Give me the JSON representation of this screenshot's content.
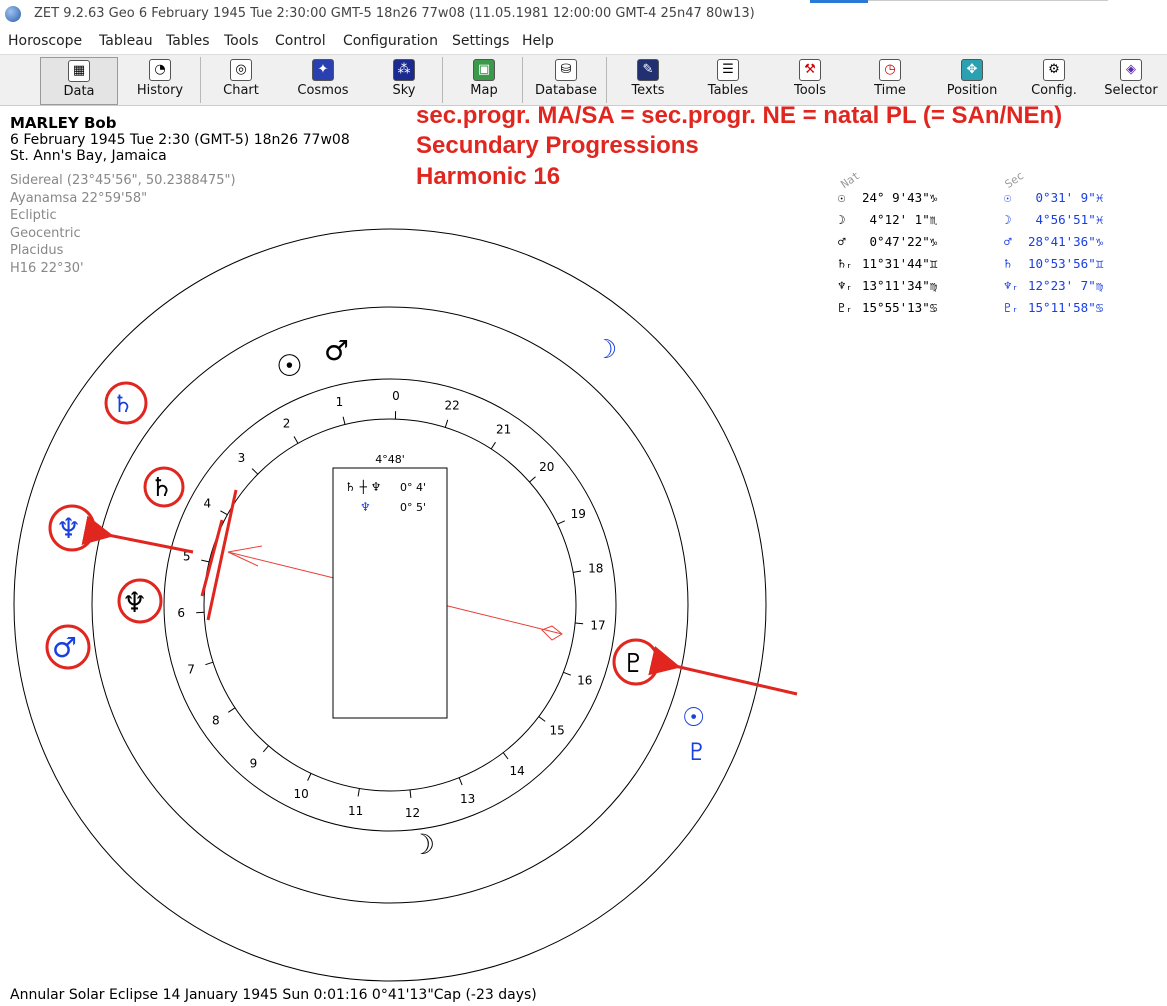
{
  "titlebar": {
    "text": "ZET 9.2.63 Geo    6 February 1945  Tue    2:30:00 GMT-5 18n26  77w08  (11.05.1981  12:00:00 GMT-4 25n47 80w13)"
  },
  "menu": [
    "Horoscope",
    "Tableau",
    "Tables",
    "Tools",
    "Control",
    "Configuration",
    "Settings",
    "Help"
  ],
  "toolbar": [
    {
      "label": "Data",
      "icon": "grid-icon"
    },
    {
      "label": "History",
      "icon": "history-icon"
    },
    {
      "label": "Chart",
      "icon": "chart-icon"
    },
    {
      "label": "Cosmos",
      "icon": "cosmos-icon"
    },
    {
      "label": "Sky",
      "icon": "sky-icon"
    },
    {
      "label": "Map",
      "icon": "map-icon"
    },
    {
      "label": "Database",
      "icon": "database-icon"
    },
    {
      "label": "Texts",
      "icon": "texts-icon"
    },
    {
      "label": "Tables",
      "icon": "tables-icon"
    },
    {
      "label": "Tools",
      "icon": "tools-icon"
    },
    {
      "label": "Time",
      "icon": "clock-icon"
    },
    {
      "label": "Position",
      "icon": "position-icon"
    },
    {
      "label": "Config.",
      "icon": "config-icon"
    },
    {
      "label": "Selector",
      "icon": "selector-icon"
    }
  ],
  "person": {
    "name": "MARLEY Bob",
    "date": "6 February 1945  Tue   2:30 (GMT-5) 18n26  77w08",
    "place": "St. Ann's Bay, Jamaica",
    "settings": [
      "Sidereal (23°45'56\", 50.2388475\")",
      "Ayanamsa 22°59'58\"",
      "Ecliptic",
      "Geocentric",
      "Placidus",
      "H16  22°30'"
    ]
  },
  "annotation": {
    "line1": "sec.progr. MA/SA = sec.progr. NE = natal PL (= SAn/NEn)",
    "line2": "Secundary Progressions",
    "line3": "Harmonic 16"
  },
  "positions": {
    "nat_header": "Nat",
    "sec_header": "Sec",
    "nat": [
      {
        "glyph": "☉",
        "value": "24° 9'43\"",
        "sign": "♑"
      },
      {
        "glyph": "☽",
        "value": " 4°12' 1\"",
        "sign": "♏"
      },
      {
        "glyph": "♂",
        "value": " 0°47'22\"",
        "sign": "♑"
      },
      {
        "glyph": "♄ᵣ",
        "value": "11°31'44\"",
        "sign": "♊"
      },
      {
        "glyph": "♆ᵣ",
        "value": "13°11'34\"",
        "sign": "♍"
      },
      {
        "glyph": "♇ᵣ",
        "value": "15°55'13\"",
        "sign": "♋"
      }
    ],
    "sec": [
      {
        "glyph": "☉",
        "value": " 0°31' 9\"",
        "sign": "♓"
      },
      {
        "glyph": "☽",
        "value": " 4°56'51\"",
        "sign": "♓"
      },
      {
        "glyph": "♂",
        "value": "28°41'36\"",
        "sign": "♑"
      },
      {
        "glyph": "♄",
        "value": "10°53'56\"",
        "sign": "♊"
      },
      {
        "glyph": "♆ᵣ",
        "value": "12°23' 7\"",
        "sign": "♍"
      },
      {
        "glyph": "♇ᵣ",
        "value": "15°11'58\"",
        "sign": "♋"
      }
    ]
  },
  "chart": {
    "center_label": "4°48'",
    "aspect_rows": [
      {
        "planets": "♄ ┼ ♆",
        "orb": "0° 4'"
      },
      {
        "planets": "♆",
        "orb": "0° 5'"
      }
    ],
    "house_numbers": [
      "1",
      "2",
      "3",
      "4",
      "5",
      "6",
      "7",
      "8",
      "9",
      "10",
      "11",
      "12",
      "13",
      "14",
      "15",
      "16",
      "17",
      "18",
      "19",
      "20",
      "21",
      "22",
      "0"
    ],
    "colors": {
      "annotation_red": "#e0261f",
      "sec_blue": "#1a3fe0",
      "aspect_red": "#e8413a"
    }
  },
  "footer": {
    "text": "Annular Solar Eclipse 14 January 1945 Sun  0:01:16  0°41'13\"Cap (-23 days)"
  }
}
